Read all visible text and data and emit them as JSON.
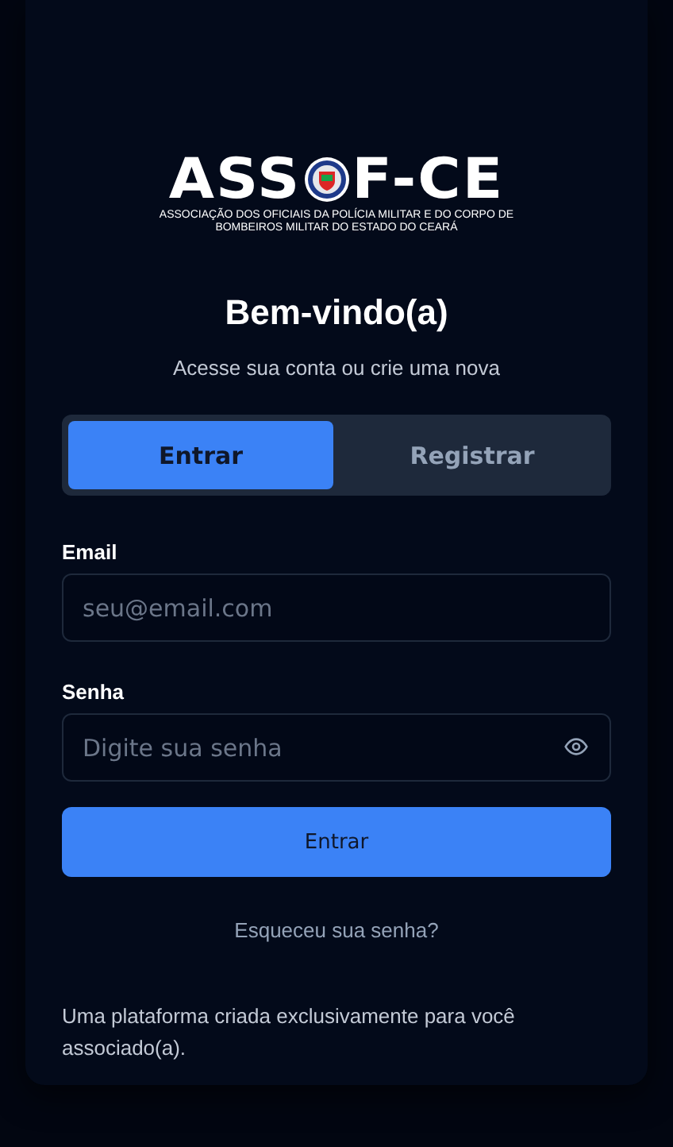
{
  "logo": {
    "word_start": "ASS",
    "word_end": "F-CE",
    "tagline": [
      "ASSOCIAÇÃO DOS OFICIAIS DA POLÍCIA MILITAR E DO CORPO DE",
      "BOMBEIROS MILITAR DO ESTADO DO CEARÁ"
    ]
  },
  "title": "Bem-vindo(a)",
  "subtitle": "Acesse sua conta ou crie uma nova",
  "tabs": [
    {
      "label": "Entrar",
      "selected": true
    },
    {
      "label": "Registrar",
      "selected": false
    }
  ],
  "fields": [
    {
      "label": "Email",
      "placeholder": "seu@email.com",
      "kind": "text"
    },
    {
      "label": "Senha",
      "placeholder": "Digite sua senha",
      "kind": "password"
    }
  ],
  "submit": "Entrar",
  "forgot_link": "Esqueceu sua senha?",
  "footer": "Uma plataforma criada exclusivamente para você associado(a)."
}
